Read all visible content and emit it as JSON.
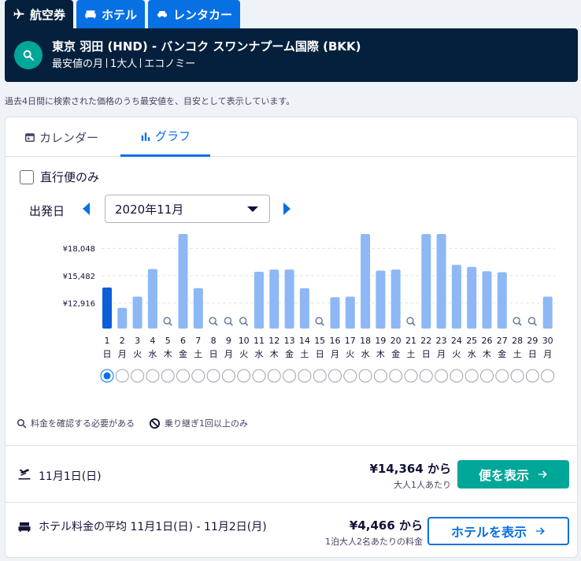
{
  "tabs": [
    {
      "label": "航空券",
      "icon": "plane-icon"
    },
    {
      "label": "ホテル",
      "icon": "bed-icon"
    },
    {
      "label": "レンタカー",
      "icon": "car-icon"
    }
  ],
  "search": {
    "title": "東京 羽田 (HND) - バンコク スワンナプーム国際 (BKK)",
    "when": "最安値の月",
    "travellers": "1大人",
    "cabin": "エコノミー"
  },
  "note": "過去4日間に検索された価格のうち最安値を、目安として表示しています。",
  "view_tabs": {
    "calendar": "カレンダー",
    "graph": "グラフ"
  },
  "direct_only": "直行便のみ",
  "departure": {
    "label": "出発日",
    "month": "2020年11月"
  },
  "chart_data": {
    "type": "bar",
    "y_ticks": [
      "¥18,048",
      "¥15,482",
      "¥12,916"
    ],
    "ylim": [
      10500,
      19400
    ],
    "days": [
      "1",
      "2",
      "3",
      "4",
      "5",
      "6",
      "7",
      "8",
      "9",
      "10",
      "11",
      "12",
      "13",
      "14",
      "15",
      "16",
      "17",
      "18",
      "19",
      "20",
      "21",
      "22",
      "23",
      "24",
      "25",
      "26",
      "27",
      "28",
      "29",
      "30"
    ],
    "weekdays": [
      "日",
      "月",
      "火",
      "水",
      "木",
      "金",
      "土",
      "日",
      "月",
      "火",
      "水",
      "木",
      "金",
      "土",
      "日",
      "月",
      "火",
      "水",
      "木",
      "金",
      "土",
      "日",
      "月",
      "火",
      "水",
      "木",
      "金",
      "土",
      "日",
      "月"
    ],
    "values": [
      14364,
      12450,
      13500,
      16100,
      null,
      19400,
      14300,
      null,
      null,
      null,
      15850,
      16050,
      16050,
      14300,
      null,
      13450,
      13500,
      19400,
      15950,
      16050,
      null,
      19400,
      19400,
      16500,
      16300,
      15900,
      15800,
      null,
      null,
      13500
    ],
    "selected_index": 0,
    "selected_color": "#0c5fd8",
    "bar_color": "#8db8f5"
  },
  "legend": {
    "check": "料金を確認する必要がある",
    "connect": "乗り継ぎ1回以上のみ"
  },
  "flight": {
    "date": "11月1日(日)",
    "price": "¥14,364 から",
    "per": "大人1人あたり",
    "button": "便を表示"
  },
  "hotel": {
    "label": "ホテル料金の平均 11月1日(日) - 11月2日(月)",
    "price": "¥4,466 から",
    "per": "1泊大人2名あたりの料金",
    "button": "ホテルを表示"
  }
}
